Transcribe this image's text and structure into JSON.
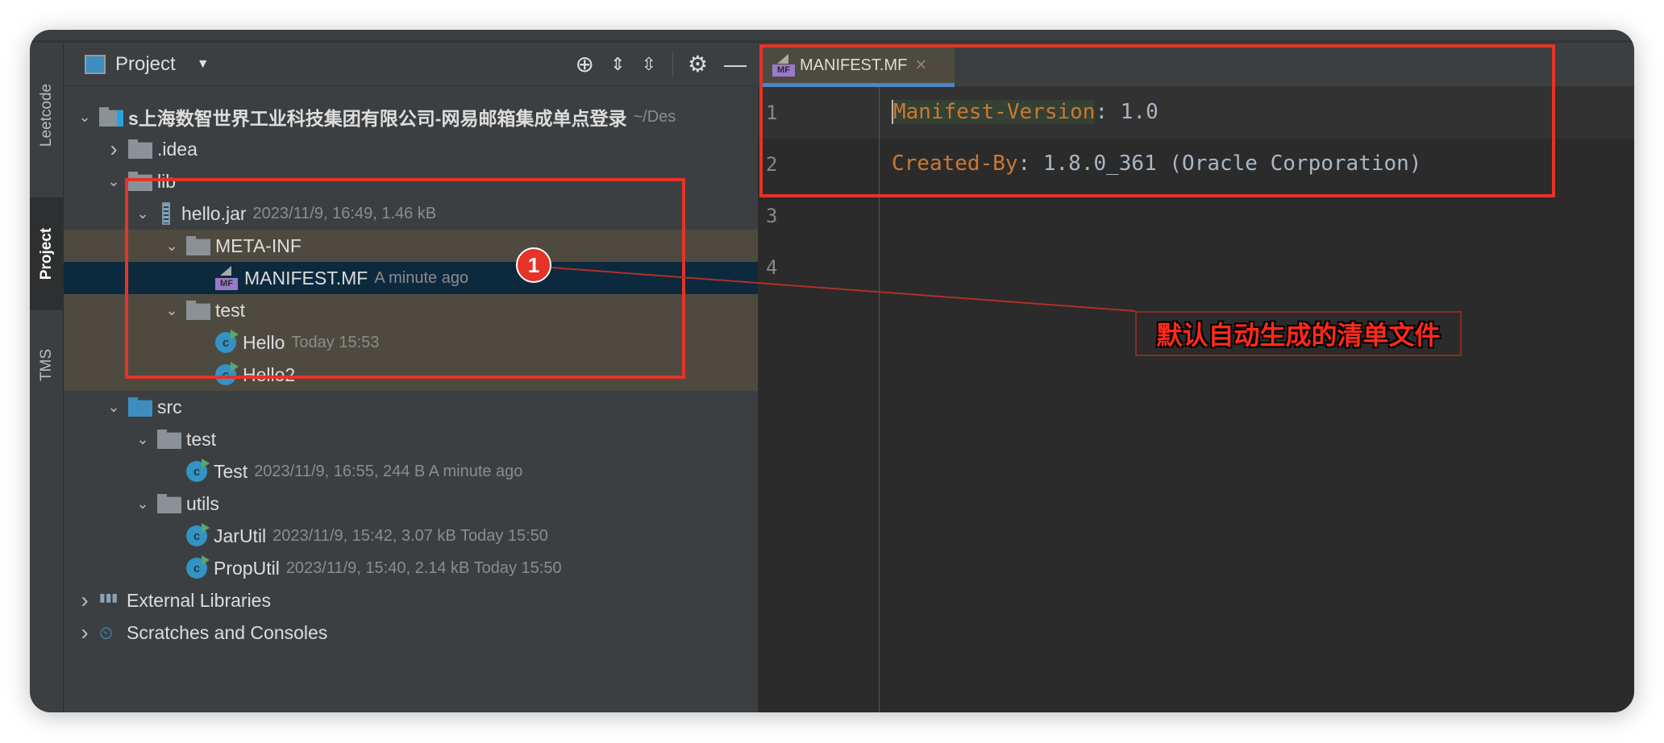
{
  "side_tabs": [
    {
      "label": "Leetcode"
    },
    {
      "label": "Project"
    },
    {
      "label": "TMS"
    }
  ],
  "panel": {
    "title": "Project",
    "toolbar_icons": [
      "locate-icon",
      "expand-all-icon",
      "collapse-all-icon",
      "gear-icon",
      "minimize-icon"
    ]
  },
  "tree": [
    {
      "label": "s上海数智世界工业科技集团有限公司-网易邮箱集成单点登录",
      "meta": "~/Des",
      "depth": 0,
      "chev": "v",
      "icon": "module"
    },
    {
      "label": ".idea",
      "meta": "",
      "depth": 1,
      "chev": ">",
      "icon": "folder"
    },
    {
      "label": "lib",
      "meta": "",
      "depth": 1,
      "chev": "v",
      "icon": "folder"
    },
    {
      "label": "hello.jar",
      "meta": "2023/11/9, 16:49, 1.46 kB",
      "depth": 2,
      "chev": "v",
      "icon": "jar"
    },
    {
      "label": "META-INF",
      "meta": "",
      "depth": 3,
      "chev": "v",
      "icon": "folder",
      "hl": "brown"
    },
    {
      "label": "MANIFEST.MF",
      "meta": "A minute ago",
      "depth": 4,
      "chev": "",
      "icon": "mf",
      "hl": "sel"
    },
    {
      "label": "test",
      "meta": "",
      "depth": 3,
      "chev": "v",
      "icon": "folder",
      "hl": "brown"
    },
    {
      "label": "Hello",
      "meta": "Today 15:53",
      "depth": 4,
      "chev": "",
      "icon": "class",
      "hl": "brown"
    },
    {
      "label": "Hello2",
      "meta": "",
      "depth": 4,
      "chev": "",
      "icon": "class",
      "hl": "brown"
    },
    {
      "label": "src",
      "meta": "",
      "depth": 1,
      "chev": "v",
      "icon": "folder-blue"
    },
    {
      "label": "test",
      "meta": "",
      "depth": 2,
      "chev": "v",
      "icon": "package"
    },
    {
      "label": "Test",
      "meta": "2023/11/9, 16:55, 244 B A minute ago",
      "depth": 3,
      "chev": "",
      "icon": "class"
    },
    {
      "label": "utils",
      "meta": "",
      "depth": 2,
      "chev": "v",
      "icon": "package"
    },
    {
      "label": "JarUtil",
      "meta": "2023/11/9, 15:42, 3.07 kB Today 15:50",
      "depth": 3,
      "chev": "",
      "icon": "class"
    },
    {
      "label": "PropUtil",
      "meta": "2023/11/9, 15:40, 2.14 kB Today 15:50",
      "depth": 3,
      "chev": "",
      "icon": "class"
    },
    {
      "label": "External Libraries",
      "meta": "",
      "depth": 0,
      "chev": ">",
      "icon": "library"
    },
    {
      "label": "Scratches and Consoles",
      "meta": "",
      "depth": 0,
      "chev": ">",
      "icon": "scratch"
    }
  ],
  "editor": {
    "tab": "MANIFEST.MF",
    "mf_badge": "MF",
    "close": "×",
    "lines": [
      {
        "num": "1",
        "key": "Manifest-Version",
        "rest": ": 1.0"
      },
      {
        "num": "2",
        "key": "Created-By",
        "rest": ": 1.8.0_361 (Oracle Corporation)"
      },
      {
        "num": "3",
        "key": "",
        "rest": ""
      },
      {
        "num": "4",
        "key": "",
        "rest": ""
      }
    ]
  },
  "annotation": {
    "badge": "1",
    "text": "默认自动生成的清单文件",
    "color": "#e53327"
  }
}
